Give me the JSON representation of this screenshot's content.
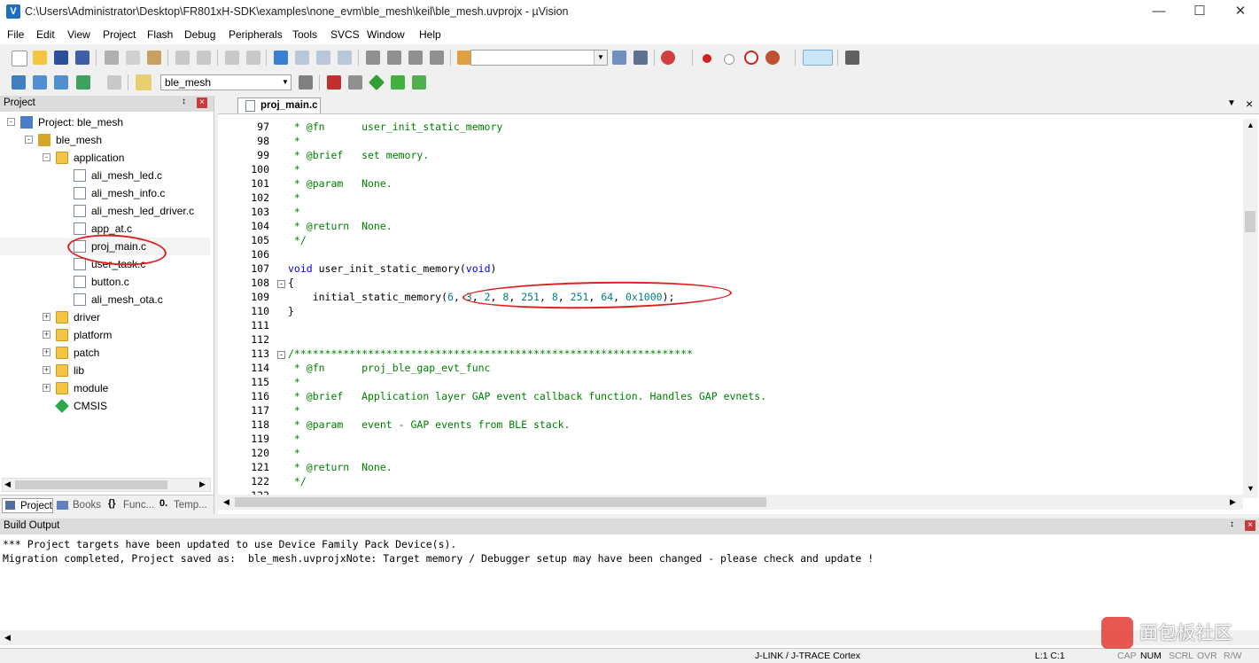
{
  "window": {
    "title": "C:\\Users\\Administrator\\Desktop\\FR801xH-SDK\\examples\\none_evm\\ble_mesh\\keil\\ble_mesh.uvprojx - µVision",
    "app_icon_letter": "V"
  },
  "menu": [
    "File",
    "Edit",
    "View",
    "Project",
    "Flash",
    "Debug",
    "Peripherals",
    "Tools",
    "SVCS",
    "Window",
    "Help"
  ],
  "toolbar2": {
    "target_combo": "ble_mesh"
  },
  "project_panel": {
    "title": "Project",
    "tree": [
      {
        "label": "Project: ble_mesh",
        "level": 0,
        "kind": "project",
        "expander": "-"
      },
      {
        "label": "ble_mesh",
        "level": 1,
        "kind": "target",
        "expander": "-"
      },
      {
        "label": "application",
        "level": 2,
        "kind": "folder",
        "expander": "-"
      },
      {
        "label": "ali_mesh_led.c",
        "level": 3,
        "kind": "file"
      },
      {
        "label": "ali_mesh_info.c",
        "level": 3,
        "kind": "file"
      },
      {
        "label": "ali_mesh_led_driver.c",
        "level": 3,
        "kind": "file"
      },
      {
        "label": "app_at.c",
        "level": 3,
        "kind": "file"
      },
      {
        "label": "proj_main.c",
        "level": 3,
        "kind": "file"
      },
      {
        "label": "user_task.c",
        "level": 3,
        "kind": "file"
      },
      {
        "label": "button.c",
        "level": 3,
        "kind": "file"
      },
      {
        "label": "ali_mesh_ota.c",
        "level": 3,
        "kind": "file"
      },
      {
        "label": "driver",
        "level": 2,
        "kind": "folder",
        "expander": "+"
      },
      {
        "label": "platform",
        "level": 2,
        "kind": "folder",
        "expander": "+"
      },
      {
        "label": "patch",
        "level": 2,
        "kind": "folder",
        "expander": "+"
      },
      {
        "label": "lib",
        "level": 2,
        "kind": "folder",
        "expander": "+"
      },
      {
        "label": "module",
        "level": 2,
        "kind": "folder",
        "expander": "+"
      },
      {
        "label": "CMSIS",
        "level": 2,
        "kind": "cmsis"
      }
    ],
    "tabs": [
      "Project",
      "Books",
      "Func...",
      "Temp..."
    ]
  },
  "editor": {
    "tab_label": "proj_main.c",
    "lines": [
      {
        "n": "97",
        "segs": [
          {
            "t": " * @fn      user_init_static_memory",
            "c": "cm"
          }
        ]
      },
      {
        "n": "98",
        "segs": [
          {
            "t": " *",
            "c": "cm"
          }
        ]
      },
      {
        "n": "99",
        "segs": [
          {
            "t": " * @brief   set memory.",
            "c": "cm"
          }
        ]
      },
      {
        "n": "100",
        "segs": [
          {
            "t": " *",
            "c": "cm"
          }
        ]
      },
      {
        "n": "101",
        "segs": [
          {
            "t": " * @param   None.",
            "c": "cm"
          }
        ]
      },
      {
        "n": "102",
        "segs": [
          {
            "t": " *",
            "c": "cm"
          }
        ]
      },
      {
        "n": "103",
        "segs": [
          {
            "t": " *",
            "c": "cm"
          }
        ]
      },
      {
        "n": "104",
        "segs": [
          {
            "t": " * @return  None.",
            "c": "cm"
          }
        ]
      },
      {
        "n": "105",
        "segs": [
          {
            "t": " */",
            "c": "cm"
          }
        ]
      },
      {
        "n": "106",
        "segs": []
      },
      {
        "n": "107",
        "segs": [
          {
            "t": "void",
            "c": "kw"
          },
          {
            "t": " user_init_static_memory(",
            "c": ""
          },
          {
            "t": "void",
            "c": "kw"
          },
          {
            "t": ")",
            "c": ""
          }
        ]
      },
      {
        "n": "108",
        "fold": "-",
        "segs": [
          {
            "t": "{",
            "c": ""
          }
        ]
      },
      {
        "n": "109",
        "segs": [
          {
            "t": "    initial_static_memory(",
            "c": ""
          },
          {
            "t": "6",
            "c": "num"
          },
          {
            "t": ", ",
            "c": ""
          },
          {
            "t": "3",
            "c": "num"
          },
          {
            "t": ", ",
            "c": ""
          },
          {
            "t": "2",
            "c": "num"
          },
          {
            "t": ", ",
            "c": ""
          },
          {
            "t": "8",
            "c": "num"
          },
          {
            "t": ", ",
            "c": ""
          },
          {
            "t": "251",
            "c": "num"
          },
          {
            "t": ", ",
            "c": ""
          },
          {
            "t": "8",
            "c": "num"
          },
          {
            "t": ", ",
            "c": ""
          },
          {
            "t": "251",
            "c": "num"
          },
          {
            "t": ", ",
            "c": ""
          },
          {
            "t": "64",
            "c": "num"
          },
          {
            "t": ", ",
            "c": ""
          },
          {
            "t": "0x1000",
            "c": "num"
          },
          {
            "t": ");",
            "c": ""
          }
        ]
      },
      {
        "n": "110",
        "segs": [
          {
            "t": "}",
            "c": ""
          }
        ]
      },
      {
        "n": "111",
        "segs": []
      },
      {
        "n": "112",
        "segs": []
      },
      {
        "n": "113",
        "fold": "-",
        "segs": [
          {
            "t": "/*****************************************************************",
            "c": "cm"
          }
        ]
      },
      {
        "n": "114",
        "segs": [
          {
            "t": " * @fn      proj_ble_gap_evt_func",
            "c": "cm"
          }
        ]
      },
      {
        "n": "115",
        "segs": [
          {
            "t": " *",
            "c": "cm"
          }
        ]
      },
      {
        "n": "116",
        "segs": [
          {
            "t": " * @brief   Application layer GAP event callback function. Handles GAP evnets.",
            "c": "cm"
          }
        ]
      },
      {
        "n": "117",
        "segs": [
          {
            "t": " *",
            "c": "cm"
          }
        ]
      },
      {
        "n": "118",
        "segs": [
          {
            "t": " * @param   event - GAP events from BLE stack.",
            "c": "cm"
          }
        ]
      },
      {
        "n": "119",
        "segs": [
          {
            "t": " *",
            "c": "cm"
          }
        ]
      },
      {
        "n": "120",
        "segs": [
          {
            "t": " *",
            "c": "cm"
          }
        ]
      },
      {
        "n": "121",
        "segs": [
          {
            "t": " * @return  None.",
            "c": "cm"
          }
        ]
      },
      {
        "n": "122",
        "segs": [
          {
            "t": " */",
            "c": "cm"
          }
        ]
      },
      {
        "n": "123",
        "segs": [
          {
            "t": "void",
            "c": "kw"
          },
          {
            "t": " proj_ble_gap_evt_func(gap_event_t *event)",
            "c": ""
          }
        ]
      }
    ]
  },
  "build_output": {
    "title": "Build Output",
    "lines": [
      "*** Project targets have been updated to use Device Family Pack Device(s).",
      "Migration completed, Project saved as:  ble_mesh.uvprojxNote: Target memory / Debugger setup may have been changed - please check and update !"
    ]
  },
  "status": {
    "debugger": "J-LINK / J-TRACE Cortex",
    "position": "L:1 C:1",
    "indicators": [
      "CAP",
      "NUM",
      "SCRL",
      "OVR",
      "R/W"
    ]
  },
  "watermark": {
    "text": "面包板社区"
  },
  "colors": {
    "accent": "#1e6fbf",
    "comment": "#008000",
    "keyword": "#0000ff",
    "number": "#008080",
    "annotation": "#e02020"
  }
}
